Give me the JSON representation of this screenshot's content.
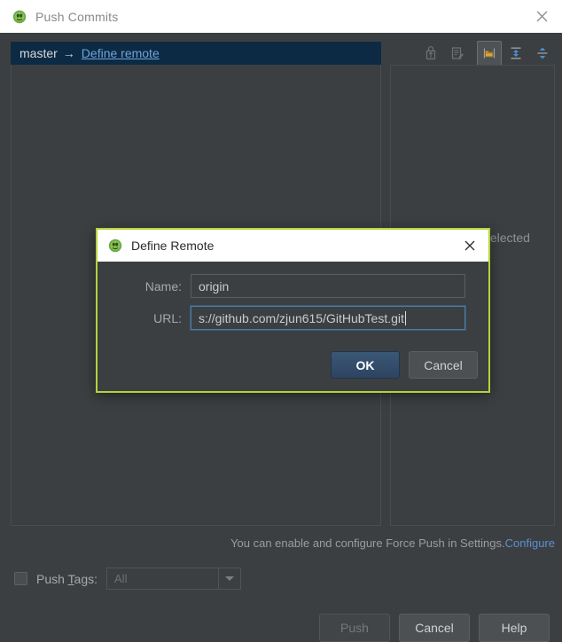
{
  "window": {
    "title": "Push Commits",
    "icon": "git-logo-icon",
    "close_icon": "close-icon"
  },
  "branch_bar": {
    "source": "master",
    "arrow": "→",
    "target_link": "Define remote"
  },
  "toolbar": {
    "buttons": [
      {
        "name": "cherry-pick-icon",
        "label": "Cherry-Pick",
        "selected": false,
        "enabled": false
      },
      {
        "name": "edit-commit-icon",
        "label": "Edit Commit Message",
        "selected": false,
        "enabled": false
      },
      {
        "name": "show-directories-icon",
        "label": "Group by Directory",
        "selected": true,
        "enabled": true
      },
      {
        "name": "expand-all-icon",
        "label": "Expand All",
        "selected": false,
        "enabled": true
      },
      {
        "name": "collapse-all-icon",
        "label": "Collapse All",
        "selected": false,
        "enabled": true
      }
    ]
  },
  "commits_panel": {
    "empty_message": "No commits selected"
  },
  "status": {
    "text": "You can enable and configure Force Push in Settings.",
    "link": "Configure"
  },
  "push_tags": {
    "checkbox_checked": false,
    "label_pre": "Push ",
    "label_mnemonic": "T",
    "label_post": "ags:",
    "combo_value": "All",
    "combo_enabled": false,
    "arrow_icon": "chevron-down-icon"
  },
  "footer_buttons": [
    {
      "name": "push-button",
      "label": "Push",
      "enabled": false
    },
    {
      "name": "cancel-button",
      "label": "Cancel",
      "enabled": true
    },
    {
      "name": "help-button",
      "label": "Help",
      "enabled": true
    }
  ],
  "dialog": {
    "title": "Define Remote",
    "icon": "git-logo-icon",
    "close_icon": "close-icon",
    "fields": {
      "name_label": "Name:",
      "name_value": "origin",
      "url_label": "URL:",
      "url_value": "s://github.com/zjun615/GitHubTest.git"
    },
    "buttons": {
      "ok": "OK",
      "cancel": "Cancel"
    }
  },
  "colors": {
    "window_bg": "#3c3f41",
    "titlebar_bg": "#ffffff",
    "branch_bar_bg": "#0d2a45",
    "link": "#6fa3d8",
    "dialog_focus_border": "#b4d33a",
    "ok_button": "#2d4461",
    "accent_folder": "#d9a441"
  }
}
